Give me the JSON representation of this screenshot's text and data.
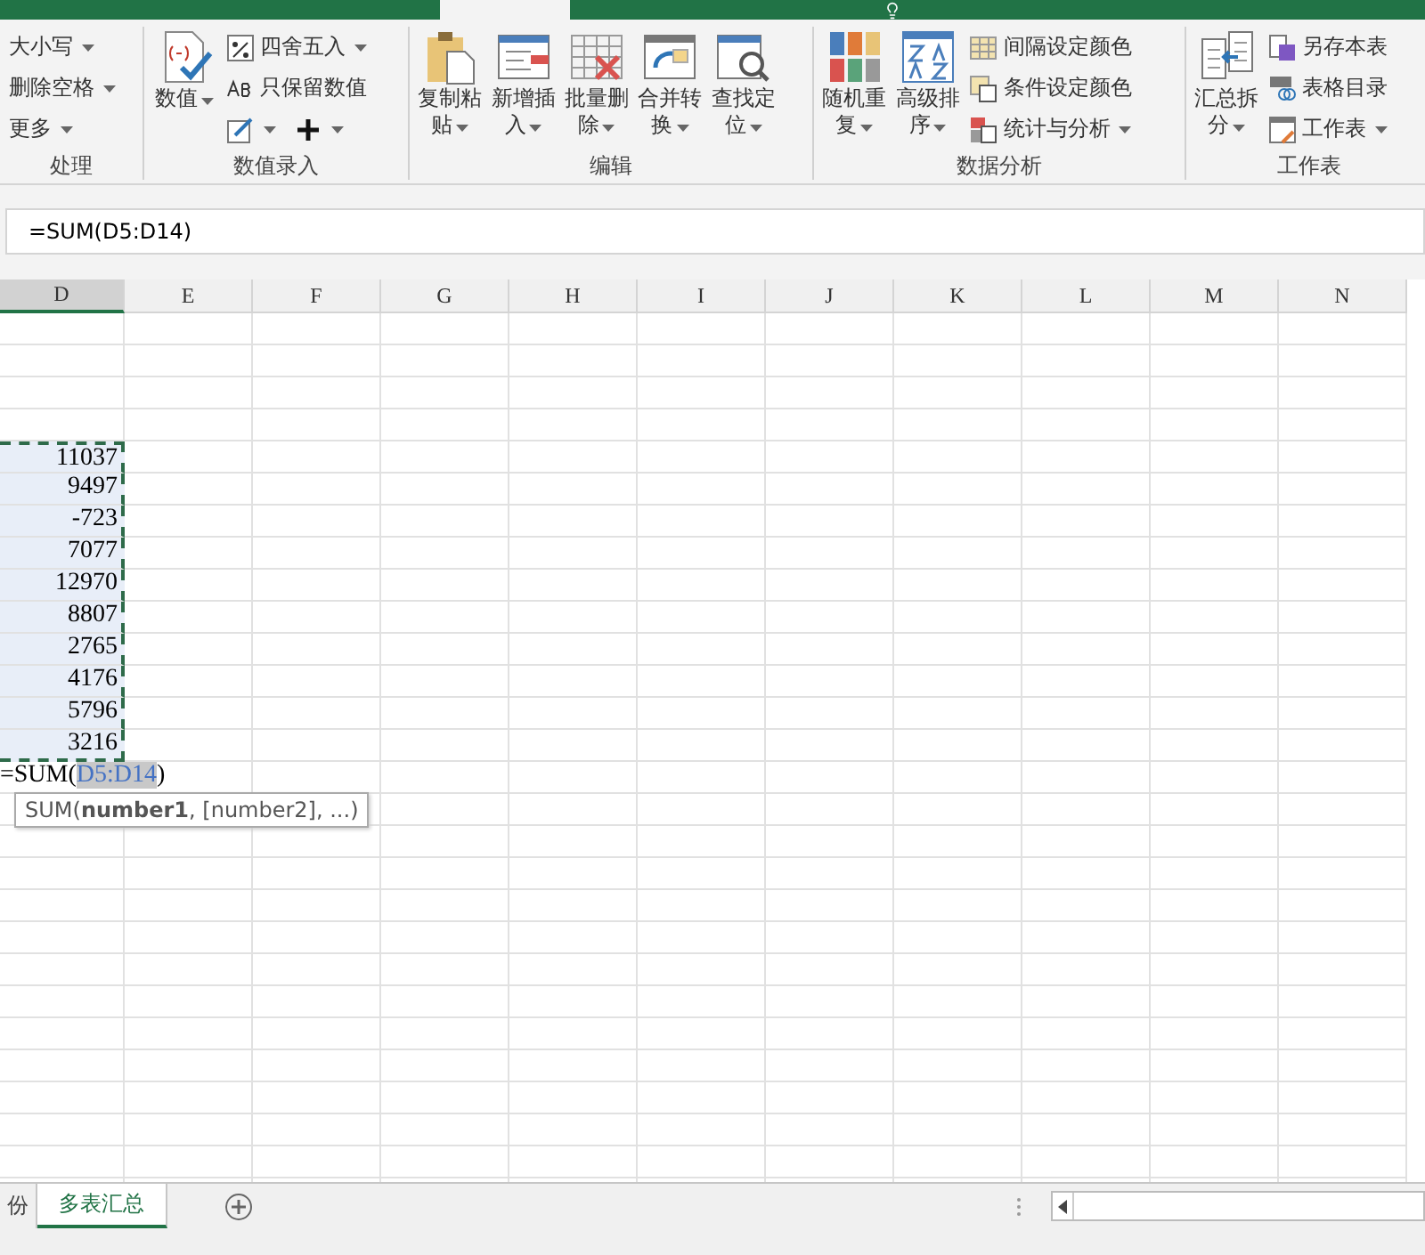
{
  "ribbon_groups": [
    {
      "kind": "cut",
      "label": "处理",
      "small": [
        {
          "label": "大小写",
          "dropdown": true
        },
        {
          "label": "删除空格",
          "dropdown": true
        },
        {
          "label": "更多",
          "dropdown": true
        }
      ]
    },
    {
      "kind": "entry",
      "label": "数值录入",
      "big": [
        {
          "label": "数值"
        }
      ],
      "small": [
        {
          "label": "四舍五入",
          "dropdown": true
        },
        {
          "label": "只保留数值",
          "dropdown": false
        },
        {
          "dropdown": true
        },
        {
          "dropdown": true
        }
      ]
    },
    {
      "kind": "edit",
      "label": "编辑",
      "big": [
        {
          "label": "复制粘贴"
        },
        {
          "label": "新增插入"
        },
        {
          "label": "批量删除"
        },
        {
          "label": "合并转换"
        },
        {
          "label": "查找定位"
        }
      ]
    },
    {
      "kind": "analysis",
      "label": "数据分析",
      "big": [
        {
          "label": "随机重复"
        },
        {
          "label": "高级排序"
        }
      ],
      "small": [
        {
          "label": "间隔设定颜色",
          "dropdown": false
        },
        {
          "label": "条件设定颜色",
          "dropdown": false
        },
        {
          "label": "统计与分析",
          "dropdown": true
        }
      ]
    },
    {
      "kind": "sheet",
      "label": "工作表",
      "big": [
        {
          "label": "汇总拆分"
        }
      ],
      "small": [
        {
          "label": "另存本表",
          "dropdown": false
        },
        {
          "label": "表格目录",
          "dropdown": false
        },
        {
          "label": "工作表",
          "dropdown": true
        }
      ]
    }
  ],
  "formula_bar": {
    "value": "=SUM(D5:D14)"
  },
  "columns": [
    {
      "label": "D",
      "selected": true
    },
    {
      "label": "E",
      "selected": false
    },
    {
      "label": "F",
      "selected": false
    },
    {
      "label": "G",
      "selected": false
    },
    {
      "label": "H",
      "selected": false
    },
    {
      "label": "I",
      "selected": false
    },
    {
      "label": "J",
      "selected": false
    },
    {
      "label": "K",
      "selected": false
    },
    {
      "label": "L",
      "selected": false
    },
    {
      "label": "M",
      "selected": false
    },
    {
      "label": "N",
      "selected": false
    }
  ],
  "column_d": {
    "values": [
      "11037",
      "9497",
      "-723",
      "7077",
      "12970",
      "8807",
      "2765",
      "4176",
      "5796",
      "3216"
    ],
    "formula_parts": [
      "=SUM(",
      "D5:D14",
      ")"
    ]
  },
  "tooltip": "SUM(**number1**, [number2], ...)",
  "sheet_tabs": [
    {
      "label": "份",
      "selected": false
    },
    {
      "label": "多表汇总",
      "selected": true
    }
  ]
}
